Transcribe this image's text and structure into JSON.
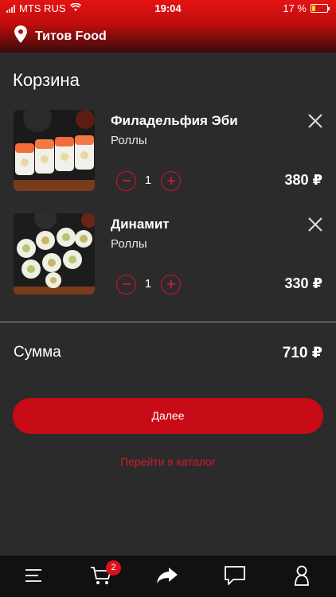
{
  "status_bar": {
    "carrier": "MTS RUS",
    "time": "19:04",
    "battery": "17 %"
  },
  "store": {
    "name": "Титов Food"
  },
  "page_title": "Корзина",
  "cart_items": [
    {
      "name": "Филадельфия Эби",
      "category": "Роллы",
      "quantity": "1",
      "price": "380 ₽"
    },
    {
      "name": "Динамит",
      "category": "Роллы",
      "quantity": "1",
      "price": "330 ₽"
    }
  ],
  "summary": {
    "label": "Сумма",
    "total": "710 ₽"
  },
  "actions": {
    "next_label": "Далее",
    "catalog_link": "Перейти в каталог"
  },
  "tab_bar": {
    "cart_badge": "2",
    "icons": [
      "menu-icon",
      "cart-icon",
      "share-icon",
      "chat-icon",
      "profile-icon"
    ]
  },
  "colors": {
    "accent": "#c70b17",
    "header": "#e41313",
    "background": "#2b2b2b",
    "tabbar": "#111111"
  }
}
